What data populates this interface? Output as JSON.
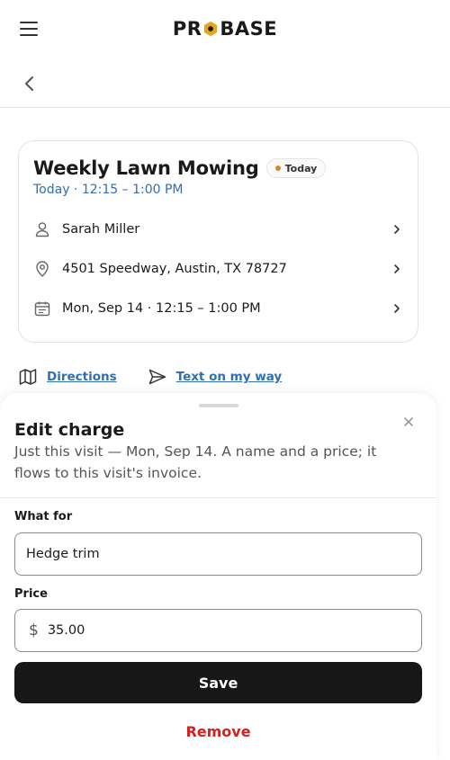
{
  "header": {
    "logo_text": "PROBASE",
    "logo_letters_left": "PR",
    "logo_letters_right": "BASE",
    "accent": "#e7a51c"
  },
  "job": {
    "title": "Weekly Lawn Mowing",
    "badge": "Today",
    "subtitle": "Today · 12:15 – 1:00 PM",
    "customer": "Sarah Miller",
    "address": "4501 Speedway, Austin, TX 78727",
    "schedule": "Mon, Sep 14 · 12:15 – 1:00 PM"
  },
  "actions": {
    "directions": "Directions",
    "text_on_my_way": "Text on my way"
  },
  "sheet": {
    "title": "Edit charge",
    "description": "Just this visit — Mon, Sep 14. A name and a price; it flows to this visit's invoice.",
    "what_for_label": "What for",
    "what_for_value": "Hedge trim",
    "price_label": "Price",
    "currency_symbol": "$",
    "price_value": "35.00",
    "save_label": "Save",
    "remove_label": "Remove"
  },
  "colors": {
    "link": "#2f6fb3",
    "danger": "#d0221f",
    "primary_button": "#171717",
    "badge_dot": "#d48a2c"
  }
}
